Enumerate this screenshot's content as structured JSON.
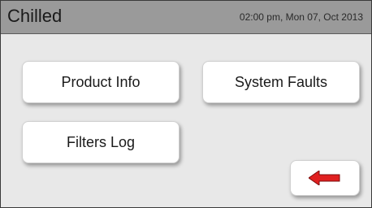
{
  "header": {
    "title": "Chilled",
    "datetime": "02:00 pm, Mon 07, Oct 2013"
  },
  "buttons": {
    "product_info": "Product Info",
    "system_faults": "System Faults",
    "filters_log": "Filters Log"
  },
  "icons": {
    "back": "back-arrow-icon"
  },
  "colors": {
    "header_bg": "#9a9a9a",
    "screen_bg": "#e8e8e8",
    "button_bg": "#ffffff",
    "arrow_red": "#e02020"
  }
}
